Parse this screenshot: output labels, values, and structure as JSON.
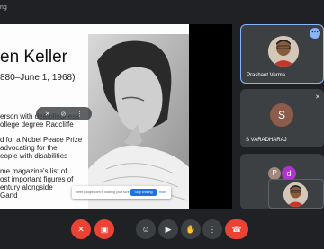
{
  "topbar": {
    "title": "ng"
  },
  "slide": {
    "title": "en Keller",
    "dates": "880–June 1, 1968)",
    "bullets": [
      "erson with deafblindness\nollege degree Radcliffe",
      "d for a Nobel Peace Prize\n advocating for the\neople with disabilities",
      "me magazine's list of\nost important figures of\nentury alongside\nGand"
    ]
  },
  "banner": {
    "text": "meet.google.com is sharing your screen.",
    "stop_label": "Stop sharing",
    "hide_label": "Hide"
  },
  "participants": [
    {
      "name": "Prashant Verma",
      "initial": ""
    },
    {
      "name": "S VARADHARAJ",
      "initial": "S"
    },
    {
      "name": "",
      "initials": [
        "P",
        "d"
      ]
    }
  ],
  "controls": {
    "mic_icon": "mic-off-icon",
    "cam_icon": "camera-off-icon",
    "emoji_icon": "emoji-icon",
    "present_icon": "present-icon",
    "hand_icon": "raise-hand-icon",
    "more_icon": "more-vert-icon",
    "end_icon": "end-call-icon"
  },
  "colors": {
    "accent": "#8ab4f8",
    "danger": "#ea4335",
    "background": "#202124",
    "tile": "#3c4043"
  }
}
